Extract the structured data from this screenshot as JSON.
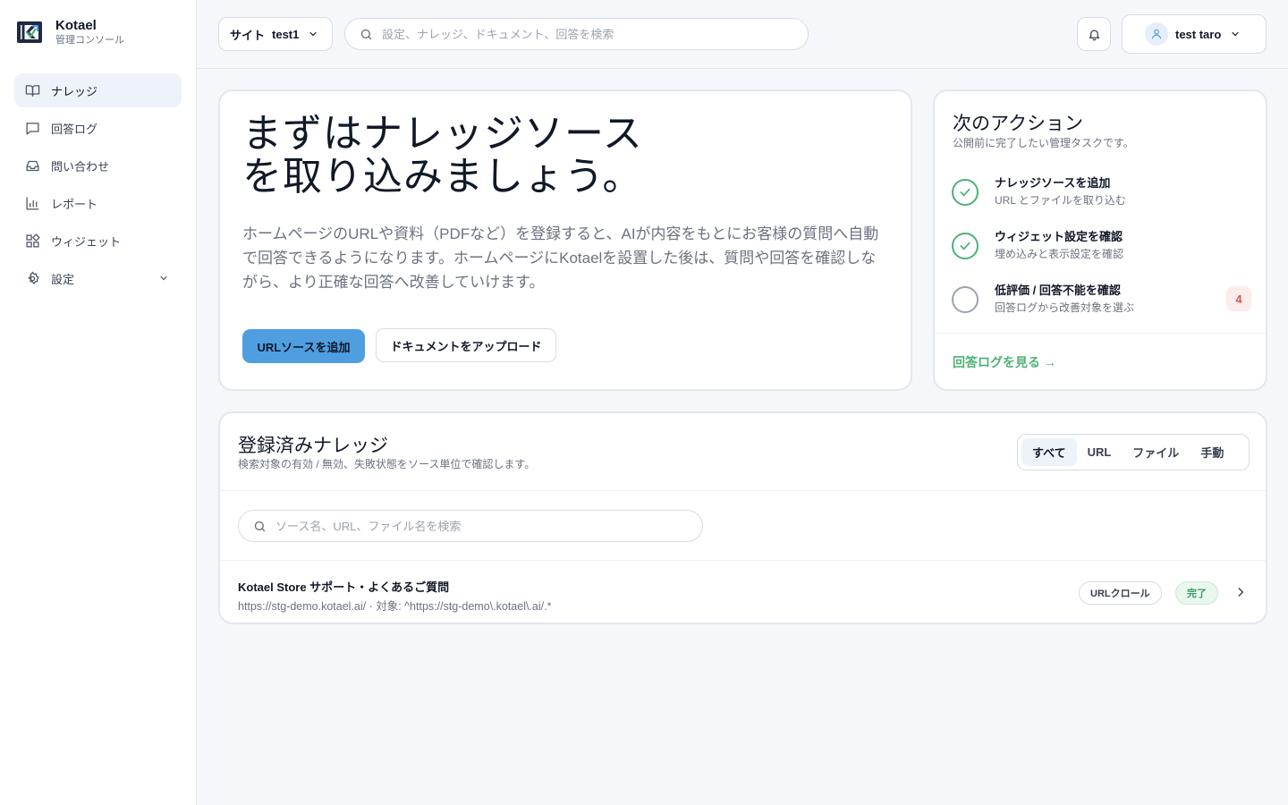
{
  "brand": {
    "name": "Kotael",
    "subtitle": "管理コンソール"
  },
  "sidebar": {
    "items": [
      {
        "label": "ナレッジ",
        "icon": "book-open-icon",
        "active": true
      },
      {
        "label": "回答ログ",
        "icon": "message-square-icon"
      },
      {
        "label": "問い合わせ",
        "icon": "inbox-icon"
      },
      {
        "label": "レポート",
        "icon": "bar-chart-icon"
      },
      {
        "label": "ウィジェット",
        "icon": "widgets-grid-icon"
      },
      {
        "label": "設定",
        "icon": "gear-icon",
        "expandable": true
      }
    ]
  },
  "header": {
    "site_label": "サイト",
    "site_value": "test1",
    "search_placeholder": "設定、ナレッジ、ドキュメント、回答を検索",
    "user_name": "test taro"
  },
  "hero": {
    "title_line1": "まずはナレッジソース",
    "title_line2": "を取り込みましょう。",
    "description": "ホームページのURLや資料（PDFなど）を登録すると、AIが内容をもとにお客様の質問へ自動で回答できるようになります。ホームページにKotaelを設置した後は、質問や回答を確認しながら、より正確な回答へ改善していけます。",
    "primary_button": "URLソースを追加",
    "secondary_button": "ドキュメントをアップロード"
  },
  "actions": {
    "title": "次のアクション",
    "subtitle": "公開前に完了したい管理タスクです。",
    "tasks": [
      {
        "title": "ナレッジソースを追加",
        "sub": "URL とファイルを取り込む",
        "done": true
      },
      {
        "title": "ウィジェット設定を確認",
        "sub": "埋め込みと表示設定を確認",
        "done": true
      },
      {
        "title": "低評価 / 回答不能を確認",
        "sub": "回答ログから改善対象を選ぶ",
        "done": false,
        "count": "4"
      }
    ],
    "link": "回答ログを見る →"
  },
  "knowledge": {
    "title": "登録済みナレッジ",
    "subtitle": "検索対象の有効 / 無効、失敗状態をソース単位で確認します。",
    "tabs": [
      {
        "label": "すべて",
        "active": true
      },
      {
        "label": "URL"
      },
      {
        "label": "ファイル"
      },
      {
        "label": "手動"
      }
    ],
    "search_placeholder": "ソース名、URL、ファイル名を検索",
    "rows": [
      {
        "title": "Kotael Store サポート・よくあるご質問",
        "sub": "https://stg-demo.kotael.ai/ · 対象: ^https://stg-demo\\.kotael\\.ai/.*",
        "type": "URLクロール",
        "status": "完了"
      }
    ]
  },
  "colors": {
    "primary": "#4f9fe0",
    "success": "#4cb277",
    "danger": "#d9534f",
    "background": "#f5f7fb"
  }
}
